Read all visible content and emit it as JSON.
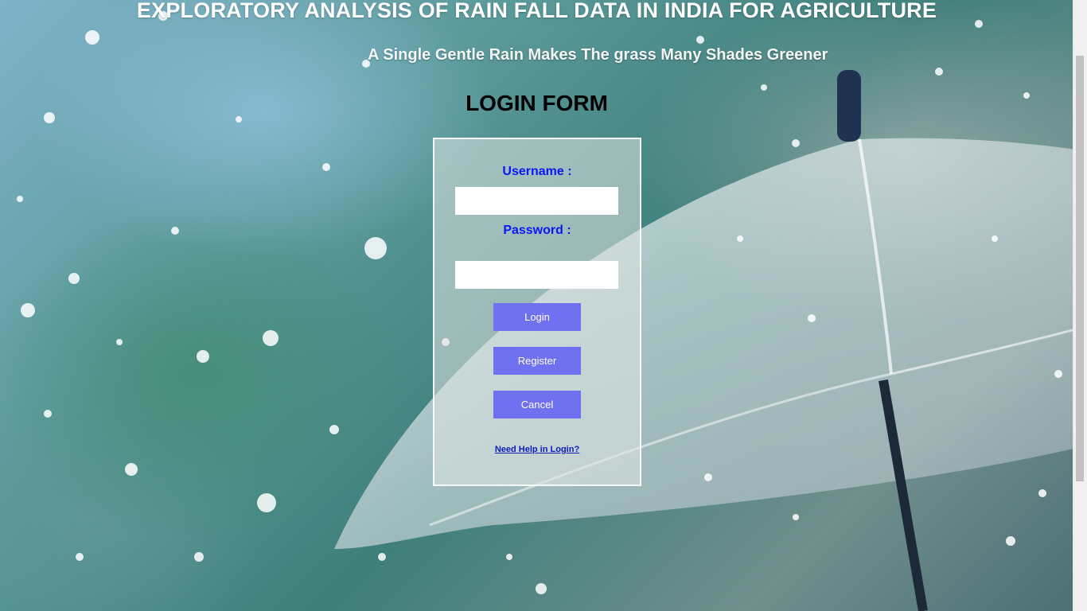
{
  "header": {
    "title": "EXPLORATORY ANALYSIS OF RAIN FALL DATA IN INDIA FOR AGRICULTURE",
    "subtitle": "A Single Gentle Rain Makes The grass Many Shades Greener"
  },
  "login_form": {
    "title": "LOGIN FORM",
    "username_label": "Username :",
    "username_value": "",
    "password_label": "Password :",
    "password_value": "",
    "login_button": "Login",
    "register_button": "Register",
    "cancel_button": "Cancel",
    "help_link": "Need Help in Login?"
  },
  "colors": {
    "label_color": "#0a18f5",
    "button_color": "#6f71f0",
    "link_color": "#0b1db8"
  }
}
